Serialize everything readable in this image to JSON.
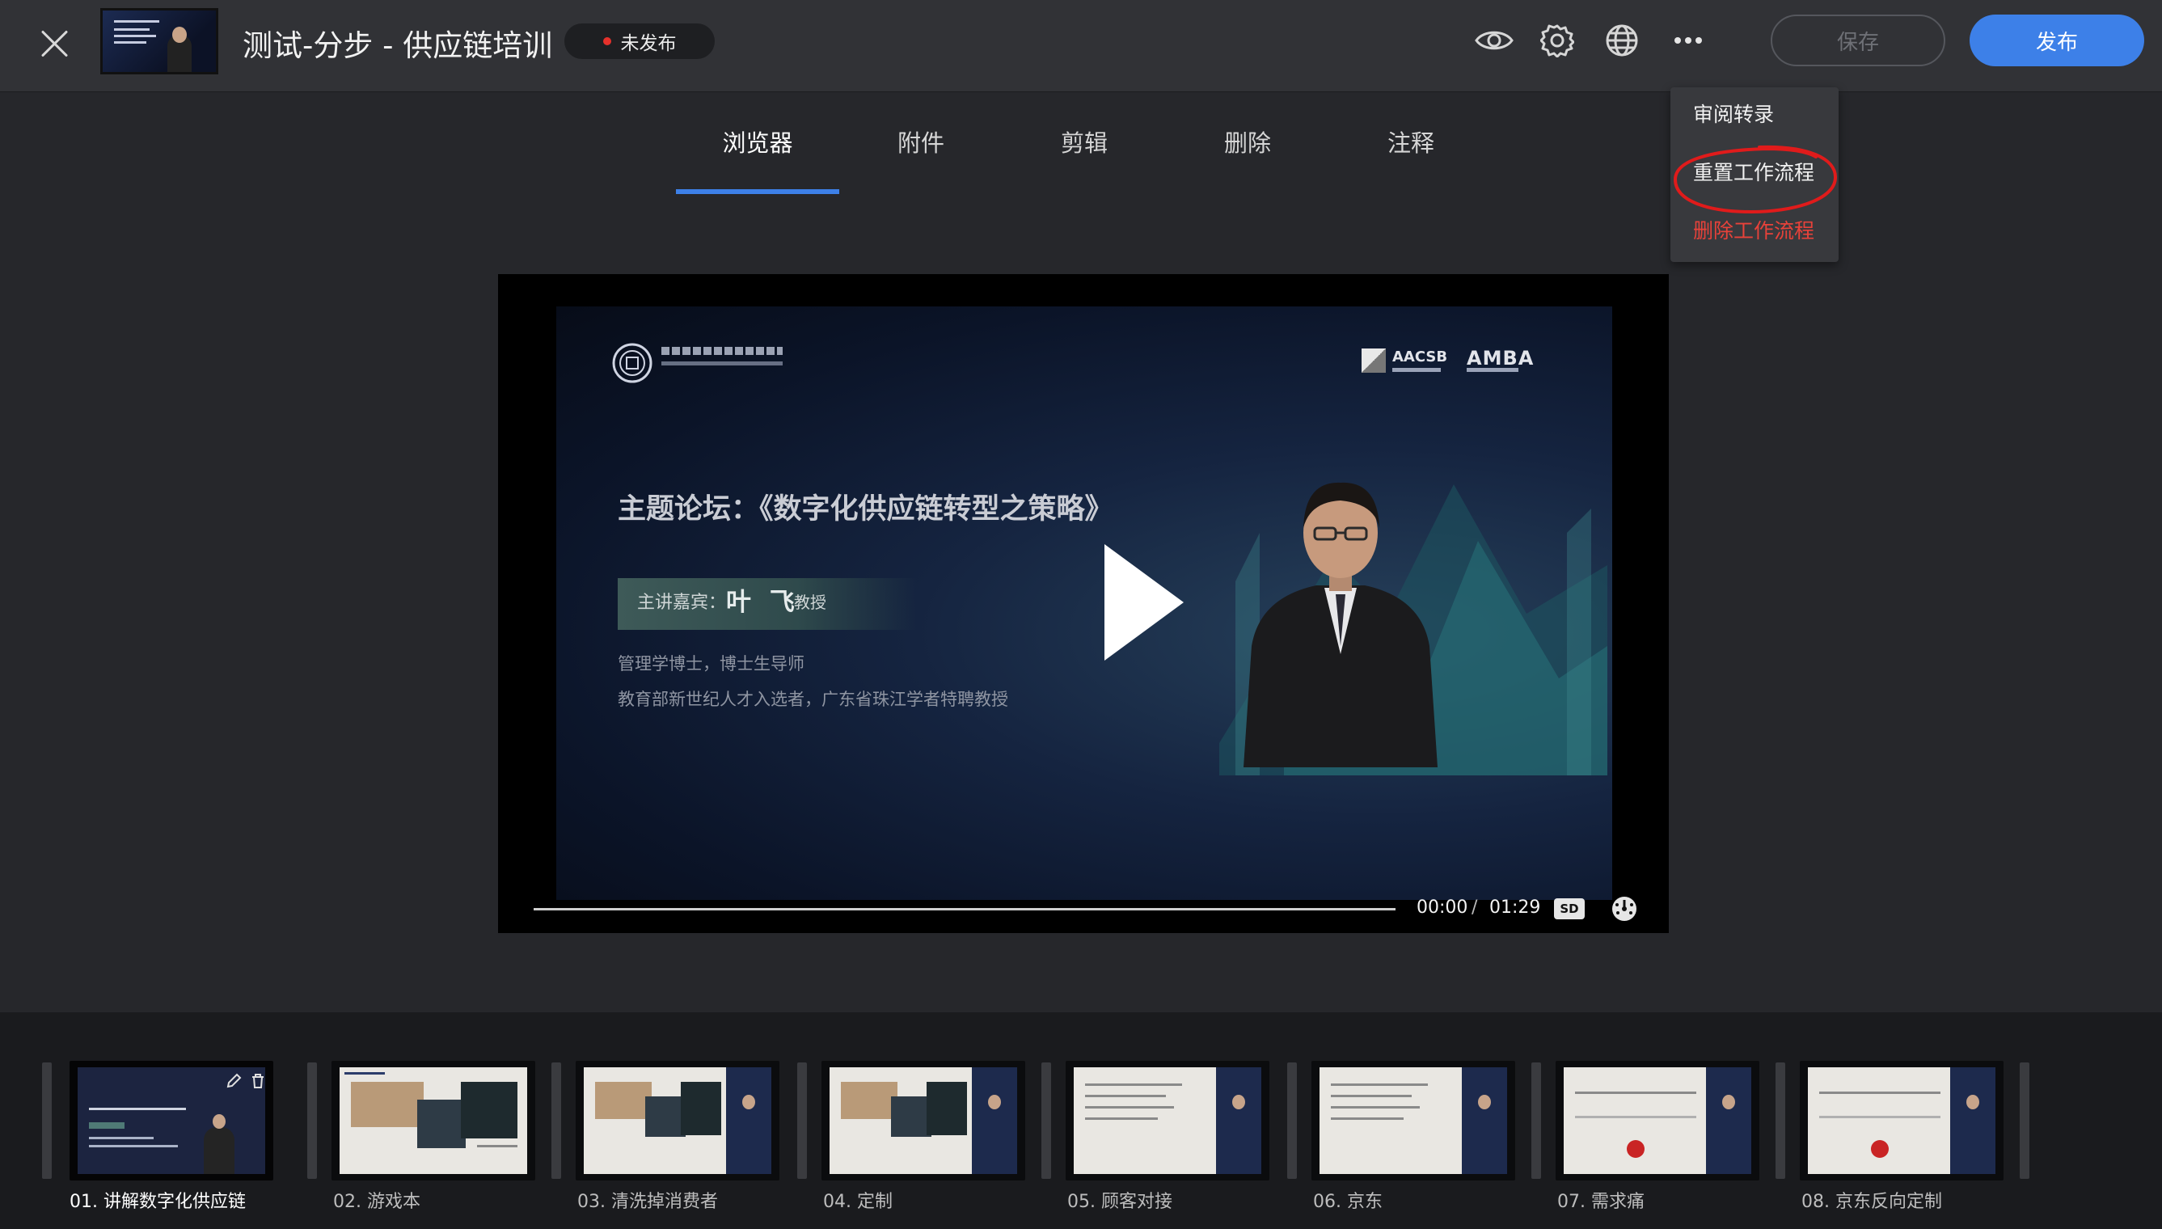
{
  "header": {
    "title": "测试-分步 - 供应链培训",
    "status": "未发布",
    "save_label": "保存",
    "publish_label": "发布"
  },
  "tabs": [
    {
      "label": "浏览器",
      "active": true
    },
    {
      "label": "附件",
      "active": false
    },
    {
      "label": "剪辑",
      "active": false
    },
    {
      "label": "删除",
      "active": false
    },
    {
      "label": "注释",
      "active": false
    }
  ],
  "more_menu": {
    "items": [
      "审阅转录",
      "重置工作流程",
      "删除工作流程"
    ]
  },
  "slide": {
    "headline": "主题论坛：《数字化供应链转型之策略》",
    "speaker_label": "主讲嘉宾：",
    "speaker_name": "叶 飞",
    "speaker_title": "教授",
    "credential_1": "管理学博士，博士生导师",
    "credential_2": "教育部新世纪人才入选者，广东省珠江学者特聘教授",
    "logo_aacsb": "AACSB",
    "logo_amba": "AMBA"
  },
  "player": {
    "current_time": "00:00",
    "separator": "/",
    "total_time": "01:29",
    "quality": "SD",
    "progress": 0
  },
  "filmstrip": [
    {
      "label": "01. 讲解数字化供应链",
      "active": true
    },
    {
      "label": "02. 游戏本",
      "active": false
    },
    {
      "label": "03. 清洗掉消费者",
      "active": false
    },
    {
      "label": "04. 定制",
      "active": false
    },
    {
      "label": "05. 顾客对接",
      "active": false
    },
    {
      "label": "06. 京东",
      "active": false
    },
    {
      "label": "07. 需求痛",
      "active": false
    },
    {
      "label": "08. 京东反向定制",
      "active": false
    }
  ],
  "colors": {
    "accent": "#3d80e8",
    "danger": "#e8423a",
    "status_dot": "#e5312b",
    "annotation": "#e01b1b"
  },
  "icons": [
    "close-icon",
    "eye-icon",
    "gear-icon",
    "globe-icon",
    "more-icon",
    "play-icon",
    "playback-speed-icon",
    "edit-icon",
    "trash-icon"
  ]
}
